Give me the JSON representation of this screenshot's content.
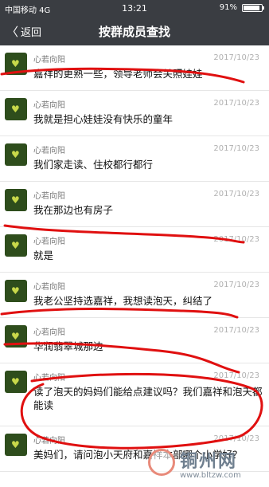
{
  "status": {
    "carrier": "中国移动  4G",
    "time": "13:21",
    "battery": "91%",
    "battery_level": 0.91
  },
  "nav": {
    "back_label": "返回",
    "title": "按群成员查找"
  },
  "messages": [
    {
      "name": "心若向阳",
      "date": "2017/10/23",
      "text": "嘉祥的更熟一些，领导老师会关照娃娃"
    },
    {
      "name": "心若向阳",
      "date": "2017/10/23",
      "text": "我就是担心娃娃没有快乐的童年"
    },
    {
      "name": "心若向阳",
      "date": "2017/10/23",
      "text": "我们家走读、住校都行都行"
    },
    {
      "name": "心若向阳",
      "date": "2017/10/23",
      "text": "我在那边也有房子"
    },
    {
      "name": "心若向阳",
      "date": "2017/10/23",
      "text": "就是"
    },
    {
      "name": "心若向阳",
      "date": "2017/10/23",
      "text": "我老公坚持选嘉祥，我想读泡天，纠结了"
    },
    {
      "name": "心若向阳",
      "date": "2017/10/23",
      "text": "华润翡翠城那边"
    },
    {
      "name": "心若向阳",
      "date": "2017/10/23",
      "text": "读了泡天的妈妈们能给点建议吗？我们嘉祥和泡天都能读"
    },
    {
      "name": "心若向阳",
      "date": "2017/10/23",
      "text": "美妈们，请问泡小天府和嘉祥本部哪个小学好？"
    }
  ],
  "watermark": {
    "name": "铜州网",
    "url": "www.bltzw.com"
  },
  "colors": {
    "bar": "#3a3d42",
    "annotation": "#e01010",
    "avatar": "#2e4d1c"
  }
}
